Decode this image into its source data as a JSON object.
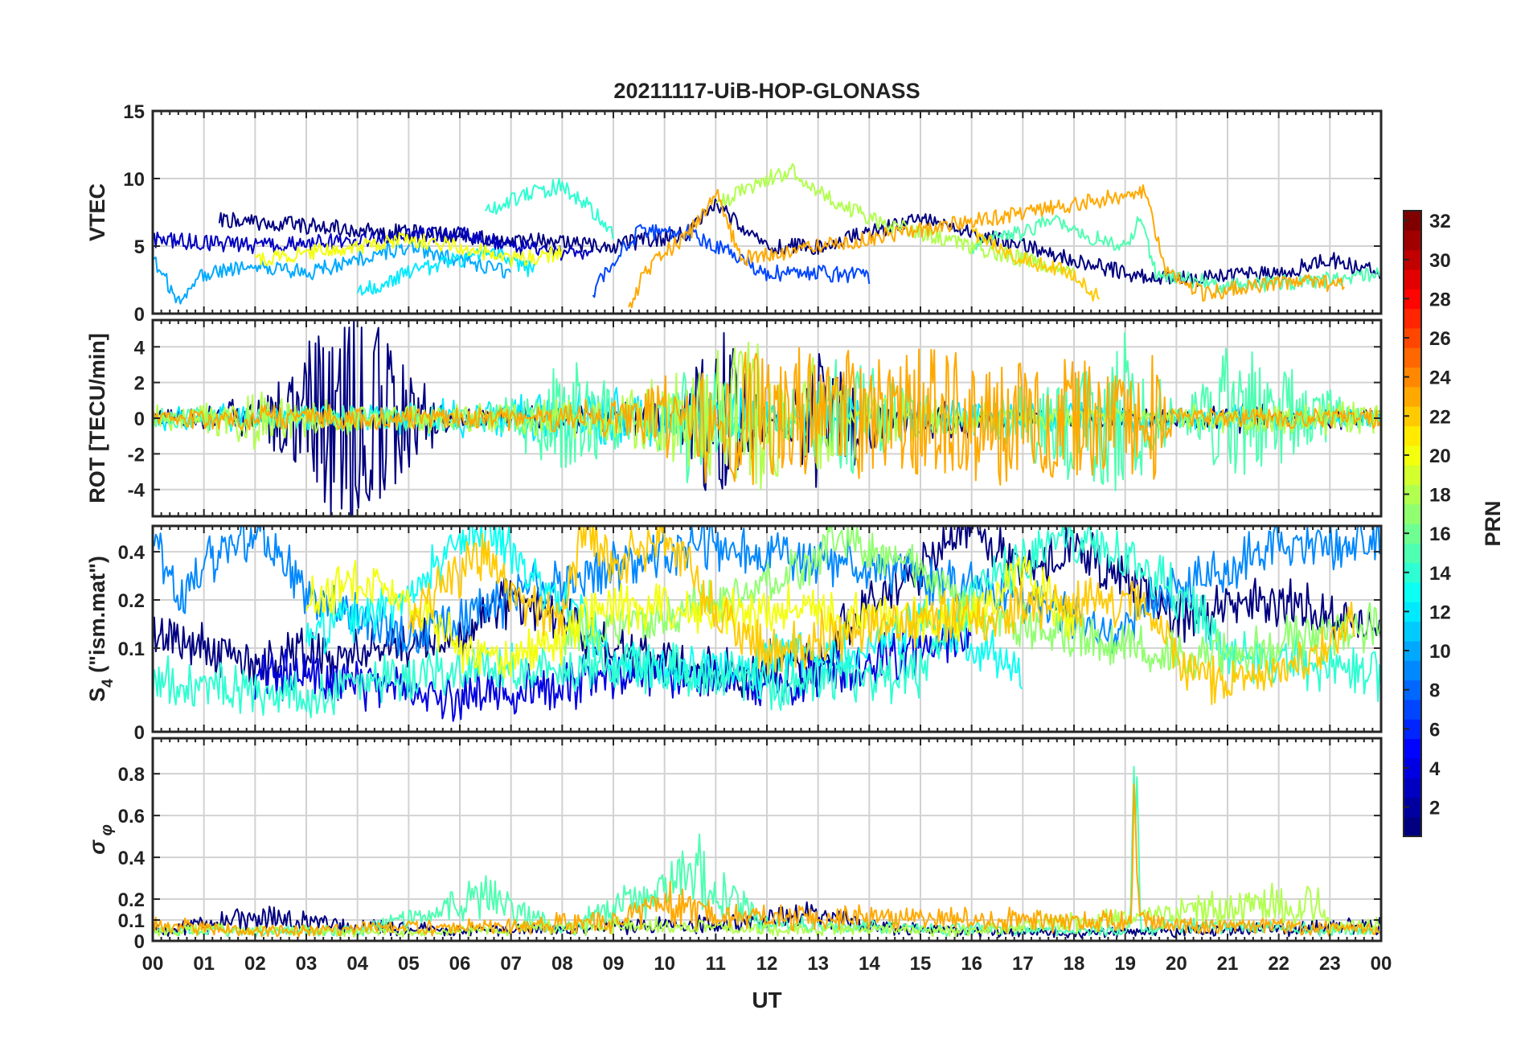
{
  "chart_data": {
    "type": "line",
    "title": "20211117-UiB-HOP-GLONASS",
    "xlabel": "UT",
    "x_ticks": [
      "00",
      "01",
      "02",
      "03",
      "04",
      "05",
      "06",
      "07",
      "08",
      "09",
      "10",
      "11",
      "12",
      "13",
      "14",
      "15",
      "16",
      "17",
      "18",
      "19",
      "20",
      "21",
      "22",
      "23",
      "00"
    ],
    "xlim_hours": [
      0,
      24
    ],
    "grid": true,
    "colorbar": {
      "label": "PRN",
      "range": [
        1,
        32
      ],
      "ticks": [
        "2",
        "4",
        "6",
        "8",
        "10",
        "12",
        "14",
        "16",
        "18",
        "20",
        "22",
        "24",
        "26",
        "28",
        "30",
        "32"
      ],
      "colormap": "jet"
    },
    "panels": [
      {
        "id": "vtec",
        "ylabel": "VTEC",
        "ylim": [
          0,
          15
        ],
        "yticks": [
          "0",
          "5",
          "10",
          "15"
        ],
        "scale": "linear",
        "series": [
          {
            "prn": 1,
            "x": [
              1.3,
              3,
              5,
              7,
              9,
              10.5,
              11,
              12,
              13,
              14,
              15,
              16,
              17,
              18,
              19,
              20,
              22,
              23,
              24
            ],
            "y": [
              7,
              6.5,
              6,
              5.5,
              5,
              6,
              8,
              5,
              5,
              6,
              7,
              6,
              5,
              4,
              3,
              2.5,
              3,
              4,
              3
            ]
          },
          {
            "prn": 3,
            "x": [
              0,
              2,
              4,
              6,
              7,
              8,
              8.6
            ],
            "y": [
              5.5,
              5,
              5.5,
              6,
              5,
              4.5,
              4.5
            ]
          },
          {
            "prn": 7,
            "x": [
              8.6,
              9,
              9.5,
              10.5,
              11,
              12,
              13,
              14
            ],
            "y": [
              1.5,
              4,
              6,
              6,
              5,
              3,
              3,
              2.8
            ]
          },
          {
            "prn": 10,
            "x": [
              0,
              0.5,
              1,
              2,
              3,
              4,
              5,
              6,
              7
            ],
            "y": [
              4,
              1,
              3,
              3.5,
              3,
              4,
              5,
              4,
              3
            ]
          },
          {
            "prn": 12,
            "x": [
              4,
              5,
              6,
              6.5,
              7,
              7.5
            ],
            "y": [
              1.5,
              3,
              4,
              4.5,
              4,
              3
            ]
          },
          {
            "prn": 14,
            "x": [
              6.5,
              7,
              7.5,
              8,
              8.5,
              9
            ],
            "y": [
              7.5,
              8.5,
              9,
              9.5,
              8,
              6
            ]
          },
          {
            "prn": 15,
            "x": [
              16,
              17,
              17.5,
              18,
              19,
              19.3,
              19.6,
              21,
              23,
              24
            ],
            "y": [
              5,
              6,
              7,
              6,
              5,
              7,
              3,
              2,
              2.5,
              3
            ]
          },
          {
            "prn": 18,
            "x": [
              11,
              12,
              12.5,
              13,
              14,
              15,
              16,
              17,
              18
            ],
            "y": [
              8,
              10,
              10.5,
              9,
              7,
              6,
              5,
              4,
              3
            ]
          },
          {
            "prn": 20,
            "x": [
              2,
              3,
              4,
              5,
              6,
              7,
              8
            ],
            "y": [
              4,
              4.5,
              5,
              5.5,
              5,
              4,
              4.5
            ]
          },
          {
            "prn": 22,
            "x": [
              16,
              17,
              18,
              18.5
            ],
            "y": [
              6,
              4,
              3,
              1
            ]
          },
          {
            "prn": 23,
            "x": [
              9.3,
              9.6,
              10,
              10.5,
              11,
              11.5,
              19.4,
              19.8,
              20.5,
              21.5,
              22.5,
              23.3
            ],
            "y": [
              0,
              3,
              4.5,
              6,
              9,
              4,
              9,
              3,
              1.5,
              2,
              2.5,
              2
            ]
          }
        ]
      },
      {
        "id": "rot",
        "ylabel": "ROT [TECU/min]",
        "ylim": [
          -5.5,
          5.5
        ],
        "yticks": [
          "-4",
          "-2",
          "0",
          "2",
          "4"
        ],
        "scale": "linear",
        "series": [
          {
            "prn": 1,
            "x": [
              0,
              2,
              4.1,
              4.15,
              6,
              10,
              10.8,
              11,
              13,
              15,
              17,
              19,
              21,
              24
            ],
            "y": [
              0,
              0.5,
              5.5,
              -4.2,
              0,
              0.5,
              -2.8,
              4,
              -3,
              0.8,
              0,
              0,
              0.3,
              0
            ]
          },
          {
            "prn": 12,
            "x": [
              0,
              3,
              6,
              9,
              12,
              15,
              18,
              21,
              24
            ],
            "y": [
              0.3,
              0.2,
              0.5,
              1,
              0.8,
              0.4,
              0.3,
              0.2,
              0
            ]
          },
          {
            "prn": 15,
            "x": [
              0,
              6,
              8.5,
              10.5,
              13.5,
              19,
              21,
              24
            ],
            "y": [
              0,
              0.3,
              -2.5,
              2.5,
              -2.5,
              3.5,
              -3,
              0.2
            ]
          },
          {
            "prn": 18,
            "x": [
              0,
              2,
              5,
              9,
              12,
              13,
              14,
              18,
              24
            ],
            "y": [
              0.5,
              -1.2,
              0.3,
              0.5,
              3.5,
              -3,
              1,
              0,
              0.5
            ]
          },
          {
            "prn": 23,
            "x": [
              0,
              3,
              6,
              9,
              10,
              10.8,
              11.3,
              19.2,
              19.5,
              20,
              24
            ],
            "y": [
              0,
              0.2,
              0,
              0.5,
              1.5,
              -2.5,
              2.8,
              2.3,
              -3,
              0,
              0
            ]
          }
        ]
      },
      {
        "id": "s4",
        "ylabel": "S4 (\"ism.mat\")",
        "ylim": [
          0.03,
          0.58
        ],
        "yticks": [
          "0",
          "0.1",
          "0.2",
          "0.4"
        ],
        "scale": "log",
        "series": [
          {
            "prn": 1,
            "x": [
              0,
              2,
              4,
              6,
              7,
              9,
              11,
              13,
              15,
              16,
              17,
              18,
              20,
              22,
              24
            ],
            "y": [
              0.12,
              0.08,
              0.1,
              0.12,
              0.2,
              0.1,
              0.07,
              0.08,
              0.3,
              0.55,
              0.3,
              0.4,
              0.15,
              0.2,
              0.12
            ]
          },
          {
            "prn": 4,
            "x": [
              2,
              4,
              6,
              8,
              10,
              12,
              14,
              16
            ],
            "y": [
              0.07,
              0.06,
              0.05,
              0.06,
              0.07,
              0.06,
              0.08,
              0.12
            ]
          },
          {
            "prn": 9,
            "x": [
              0,
              0.5,
              1,
              2,
              3,
              5,
              6,
              9.5,
              10.5,
              19,
              20,
              21,
              22,
              23,
              24
            ],
            "y": [
              0.5,
              0.2,
              0.35,
              0.5,
              0.2,
              0.12,
              0.15,
              0.35,
              0.45,
              0.12,
              0.25,
              0.3,
              0.45,
              0.4,
              0.5
            ]
          },
          {
            "prn": 13,
            "x": [
              3,
              5,
              6,
              6.5,
              7,
              7.5,
              9,
              11,
              14,
              15,
              17
            ],
            "y": [
              0.12,
              0.2,
              0.45,
              0.55,
              0.4,
              0.25,
              0.08,
              0.07,
              0.1,
              0.15,
              0.07
            ]
          },
          {
            "prn": 14,
            "x": [
              0,
              3,
              6,
              9,
              12,
              15,
              18,
              21,
              24
            ],
            "y": [
              0.06,
              0.05,
              0.07,
              0.08,
              0.06,
              0.07,
              0.5,
              0.09,
              0.07
            ]
          },
          {
            "prn": 17,
            "x": [
              8,
              10,
              12,
              13,
              13.5,
              14,
              15,
              16,
              19,
              21,
              23,
              24
            ],
            "y": [
              0.12,
              0.15,
              0.25,
              0.35,
              0.5,
              0.4,
              0.3,
              0.15,
              0.1,
              0.09,
              0.12,
              0.15
            ]
          },
          {
            "prn": 20,
            "x": [
              3,
              4,
              5,
              6,
              7,
              8,
              9,
              16,
              17,
              18
            ],
            "y": [
              0.2,
              0.25,
              0.2,
              0.1,
              0.08,
              0.12,
              0.18,
              0.15,
              0.3,
              0.12
            ]
          },
          {
            "prn": 22,
            "x": [
              5,
              6,
              6.5,
              7,
              8,
              8.5,
              9,
              10,
              11,
              12,
              18.5,
              19.5,
              20,
              21,
              22.5,
              23.5
            ],
            "y": [
              0.15,
              0.3,
              0.4,
              0.2,
              0.15,
              0.55,
              0.3,
              0.5,
              0.15,
              0.1,
              0.2,
              0.17,
              0.08,
              0.06,
              0.08,
              0.15
            ]
          }
        ]
      },
      {
        "id": "sigma_phi",
        "ylabel": "σφ",
        "ylim": [
          0,
          0.97
        ],
        "yticks": [
          "0",
          "0.1",
          "0.2",
          "0.4",
          "0.6",
          "0.8"
        ],
        "scale": "linear",
        "series": [
          {
            "prn": 1,
            "x": [
              0,
              2,
              4,
              6,
              8,
              10,
              12,
              13,
              14,
              16,
              18,
              20,
              22,
              24
            ],
            "y": [
              0.05,
              0.12,
              0.08,
              0.05,
              0.06,
              0.08,
              0.1,
              0.15,
              0.07,
              0.05,
              0.04,
              0.05,
              0.06,
              0.08
            ]
          },
          {
            "prn": 15,
            "x": [
              0,
              4,
              6.5,
              8,
              10.6,
              12,
              19.1,
              19.2,
              19.3,
              20,
              24
            ],
            "y": [
              0.05,
              0.05,
              0.22,
              0.05,
              0.35,
              0.08,
              0.05,
              0.95,
              0.05,
              0.08,
              0.05
            ]
          },
          {
            "prn": 18,
            "x": [
              0,
              5,
              9,
              12,
              16,
              22.8,
              23,
              24
            ],
            "y": [
              0.06,
              0.04,
              0.08,
              0.06,
              0.05,
              0.2,
              0.06,
              0.08
            ]
          },
          {
            "prn": 23,
            "x": [
              0,
              2,
              6,
              9,
              10,
              11,
              19.1,
              19.2,
              19.3,
              20,
              24
            ],
            "y": [
              0.08,
              0.05,
              0.07,
              0.1,
              0.2,
              0.12,
              0.1,
              0.7,
              0.1,
              0.08,
              0.06
            ]
          }
        ]
      }
    ]
  }
}
